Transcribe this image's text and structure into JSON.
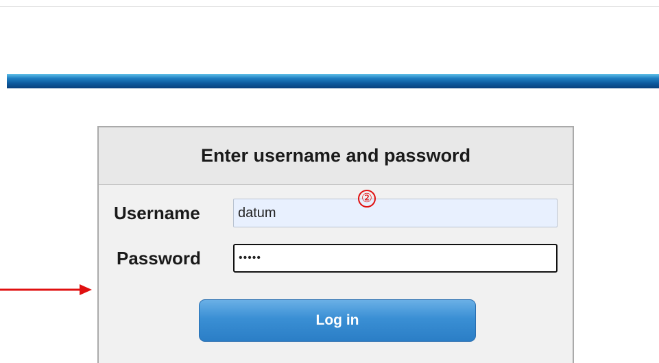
{
  "login": {
    "title": "Enter username and password",
    "username_label": "Username",
    "username_value": "datum",
    "password_label": "Password",
    "password_value": "•••••",
    "login_button_label": "Log in"
  },
  "annotations": {
    "step_marker": "②",
    "marker_color": "#e01010",
    "arrow_color": "#e01010"
  },
  "colors": {
    "header_bar": "#0d5a9e",
    "button": "#3a8fd4",
    "username_field_bg": "#e8f0fe"
  }
}
